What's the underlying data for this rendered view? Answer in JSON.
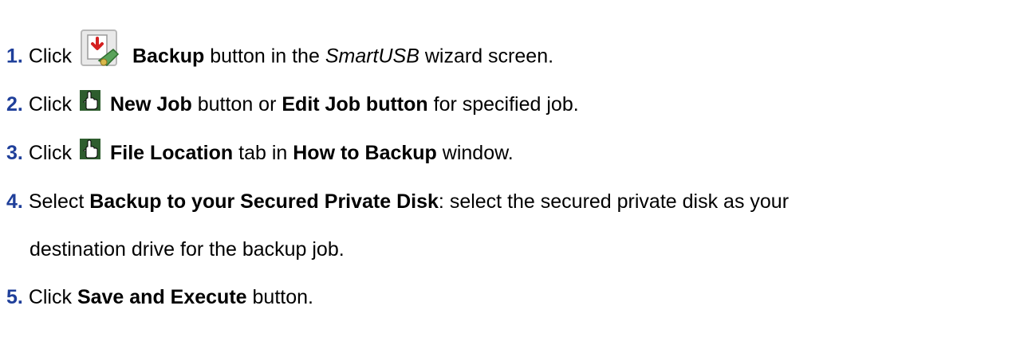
{
  "steps": [
    {
      "number": "1.",
      "parts": [
        "Click",
        "Backup",
        "button in the",
        "SmartUSB",
        "wizard screen."
      ],
      "icon": "backup-icon"
    },
    {
      "number": "2.",
      "parts": [
        "Click",
        "New Job",
        "button or",
        "Edit Job button",
        "for specified job."
      ],
      "icon": "pointing-hand-icon"
    },
    {
      "number": "3.",
      "parts": [
        "Click",
        "File Location",
        "tab in",
        "How to Backup",
        "window."
      ],
      "icon": "pointing-hand-icon"
    },
    {
      "number": "4.",
      "parts": [
        "Select",
        "Backup to your Secured Private Disk",
        ": select the secured private disk as your",
        "destination drive for the backup job."
      ]
    },
    {
      "number": "5.",
      "parts": [
        "Click",
        "Save and Execute",
        "button."
      ]
    }
  ],
  "colors": {
    "step_number": "#1f3f9a",
    "text": "#000000"
  }
}
